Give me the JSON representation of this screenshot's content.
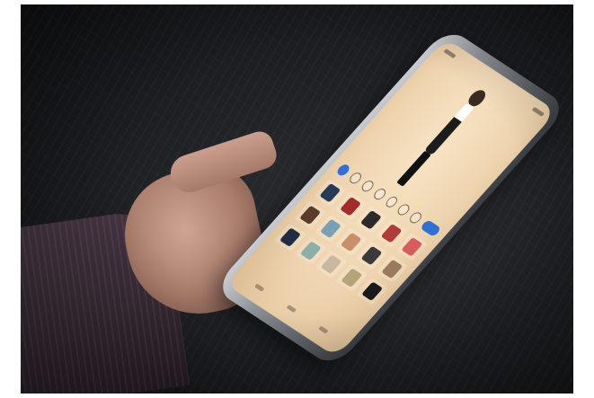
{
  "scene": {
    "kind": "photo",
    "background_color": "#1c1e21",
    "sleeve_color": "#3a2c37",
    "skin_color": "#a97c6b",
    "phone_frame_color": "#8f949a",
    "screen_color": "#eed4ae",
    "accent_color": "#2f6fd6"
  },
  "app_screen": {
    "toolbar_icons": [
      "camera-icon",
      "shirt-icon",
      "dress-icon",
      "shoe-icon",
      "bag-icon",
      "hat-icon",
      "star-icon"
    ],
    "wardrobe_items": [
      {
        "name": "jacket-item",
        "color": "#263a5a"
      },
      {
        "name": "bow-item",
        "color": "#a52a2a"
      },
      {
        "name": "top-item",
        "color": "#2b2b2b"
      },
      {
        "name": "skirt-item",
        "color": "#b23a3a"
      },
      {
        "name": "scarf-item",
        "color": "#d95b5b"
      },
      {
        "name": "boots-item",
        "color": "#5a3a2a"
      },
      {
        "name": "shirt-item",
        "color": "#7aa0b5"
      },
      {
        "name": "sweater-item",
        "color": "#c98f6a"
      },
      {
        "name": "pants-item",
        "color": "#3a3a3a"
      },
      {
        "name": "hat-item",
        "color": "#9a7a5a"
      },
      {
        "name": "coat-item",
        "color": "#1f2c44"
      },
      {
        "name": "dress-item",
        "color": "#8ab0a8"
      },
      {
        "name": "shorts-item",
        "color": "#c9b8a0"
      },
      {
        "name": "vest-item",
        "color": "#b5a37a"
      },
      {
        "name": "gown-item",
        "color": "#1a1a1a"
      }
    ]
  }
}
